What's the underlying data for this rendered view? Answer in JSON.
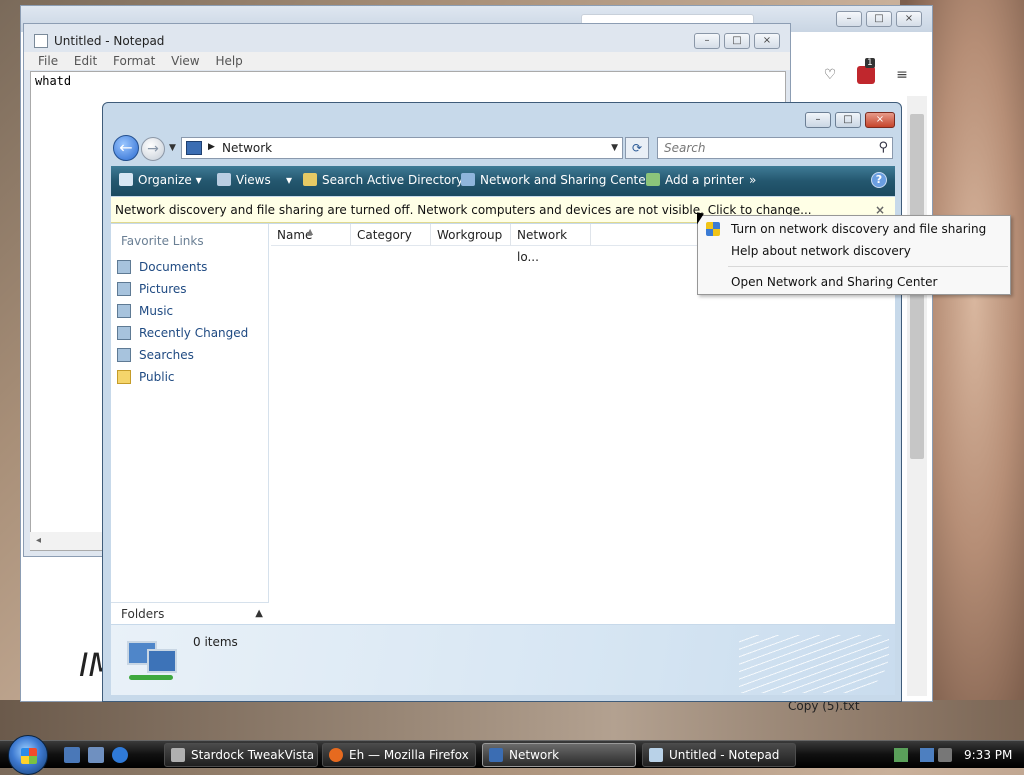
{
  "firefox": {
    "badge_count": "1"
  },
  "desktop": {
    "caption": "Copy (5).txt",
    "imm_text": "IMI"
  },
  "notepad": {
    "title": "Untitled - Notepad",
    "menu": [
      "File",
      "Edit",
      "Format",
      "View",
      "Help"
    ],
    "content": "whatd"
  },
  "explorer": {
    "address": "Network",
    "search_placeholder": "Search",
    "commands": {
      "organize": "Organize",
      "views": "Views",
      "search_ad": "Search Active Directory",
      "network_center": "Network and Sharing Center",
      "add_printer": "Add a printer",
      "more": "»",
      "help": "?"
    },
    "infobar": "Network discovery and file sharing are turned off. Network computers and devices are not visible. Click to change...",
    "favorite_links_title": "Favorite Links",
    "favorites": [
      "Documents",
      "Pictures",
      "Music",
      "Recently Changed",
      "Searches",
      "Public"
    ],
    "columns": [
      "Name",
      "Category",
      "Workgroup",
      "Network lo..."
    ],
    "folders_label": "Folders",
    "item_count": "0 items"
  },
  "context_menu": {
    "items": [
      "Turn on network discovery and file sharing",
      "Help about network discovery",
      "Open Network and Sharing Center"
    ]
  },
  "taskbar": {
    "tasks": [
      "Stardock TweakVista",
      "Eh — Mozilla Firefox",
      "Network",
      "Untitled - Notepad"
    ],
    "clock": "9:33 PM"
  },
  "colors": {
    "command_bar": "#24576f",
    "infobar_bg": "#ffffe6",
    "link_text": "#1f4a82"
  }
}
